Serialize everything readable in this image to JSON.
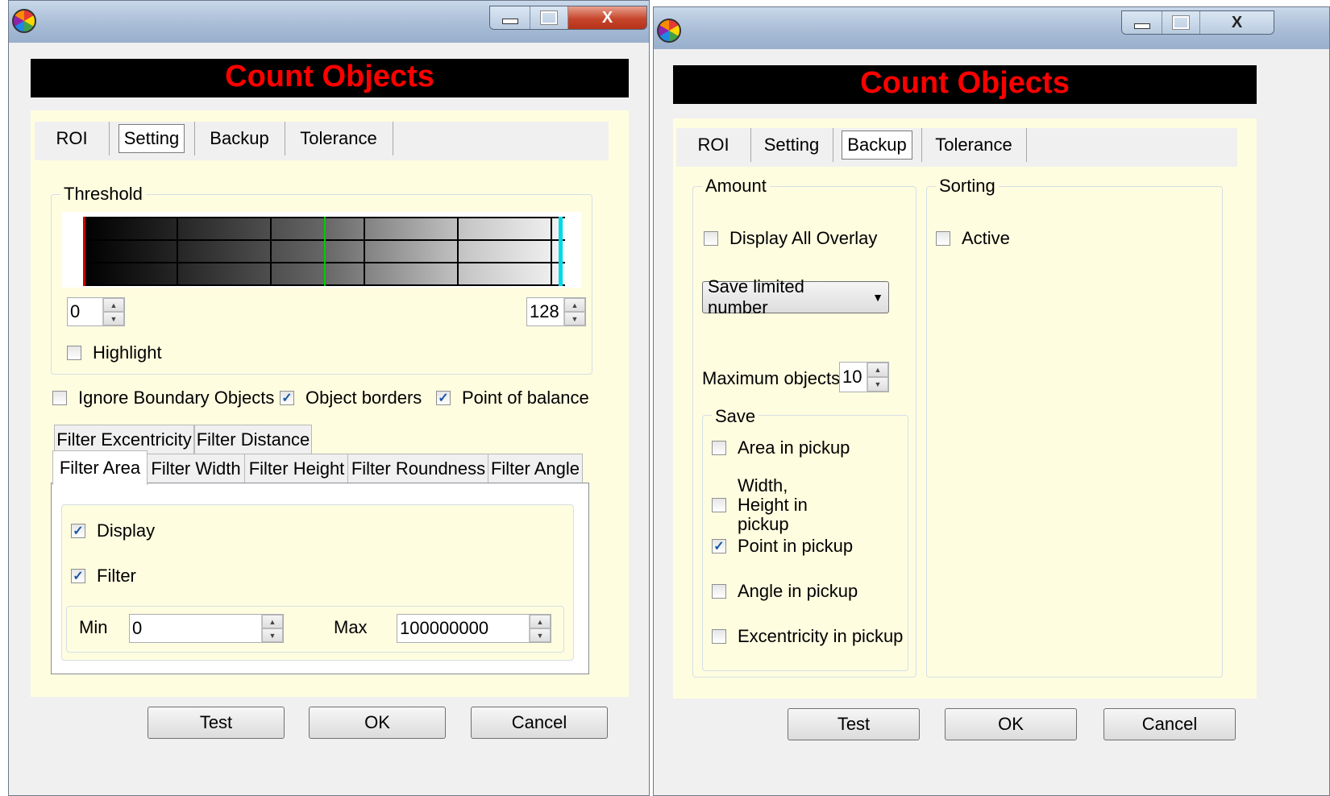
{
  "left_window": {
    "banner_title": "Count Objects",
    "tabs": [
      {
        "label": "ROI"
      },
      {
        "label": "Setting",
        "active": true
      },
      {
        "label": "Backup"
      },
      {
        "label": "Tolerance"
      }
    ],
    "threshold": {
      "group_label": "Threshold",
      "min_value": "0",
      "max_value": "128",
      "highlight_label": "Highlight",
      "highlight_checked": false
    },
    "options": [
      {
        "label": "Ignore Boundary Objects",
        "checked": false
      },
      {
        "label": "Object borders",
        "checked": true
      },
      {
        "label": "Point of balance",
        "checked": true
      }
    ],
    "filter_tabs_row1": [
      {
        "label": "Filter Excentricity"
      },
      {
        "label": "Filter Distance"
      }
    ],
    "filter_tabs_row2": [
      {
        "label": "Filter Area",
        "active": true
      },
      {
        "label": "Filter Width"
      },
      {
        "label": "Filter Height"
      },
      {
        "label": "Filter Roundness"
      },
      {
        "label": "Filter Angle"
      }
    ],
    "filter_area": {
      "display_label": "Display",
      "display_checked": true,
      "filter_label": "Filter",
      "filter_checked": true,
      "min_label": "Min",
      "min_value": "0",
      "max_label": "Max",
      "max_value": "100000000"
    },
    "buttons": {
      "test": "Test",
      "ok": "OK",
      "cancel": "Cancel"
    }
  },
  "right_window": {
    "banner_title": "Count Objects",
    "tabs": [
      {
        "label": "ROI"
      },
      {
        "label": "Setting"
      },
      {
        "label": "Backup",
        "active": true
      },
      {
        "label": "Tolerance"
      }
    ],
    "amount": {
      "group_label": "Amount",
      "display_all_overlay_label": "Display All Overlay",
      "display_all_overlay_checked": false,
      "save_mode_selected": "Save limited number",
      "maximum_objects_label": "Maximum objects",
      "maximum_objects_value": "10",
      "save": {
        "group_label": "Save",
        "items": [
          {
            "label": "Area in pickup",
            "checked": false
          },
          {
            "label": "Width, Height in pickup",
            "checked": false
          },
          {
            "label": "Point in pickup",
            "checked": true
          },
          {
            "label": "Angle in pickup",
            "checked": false
          },
          {
            "label": "Excentricity in pickup",
            "checked": false
          }
        ]
      }
    },
    "sorting": {
      "group_label": "Sorting",
      "active_label": "Active",
      "active_checked": false
    },
    "buttons": {
      "test": "Test",
      "ok": "OK",
      "cancel": "Cancel"
    }
  },
  "colors": {
    "banner_background": "#000000",
    "banner_text": "#ff0000",
    "panel_background": "#fffde0",
    "threshold_low_marker": "#cc0000",
    "threshold_mid_marker": "#00cc00",
    "threshold_high_marker": "#00d8e8",
    "checkmark": "#1a57a4"
  },
  "icons": {
    "app": "app-logo-icon",
    "minimize": "minimize-icon",
    "maximize": "maximize-icon",
    "close": "close-icon",
    "spin_up": "spin-up-icon",
    "spin_down": "spin-down-icon",
    "dropdown": "chevron-down-icon",
    "check": "check-icon"
  }
}
